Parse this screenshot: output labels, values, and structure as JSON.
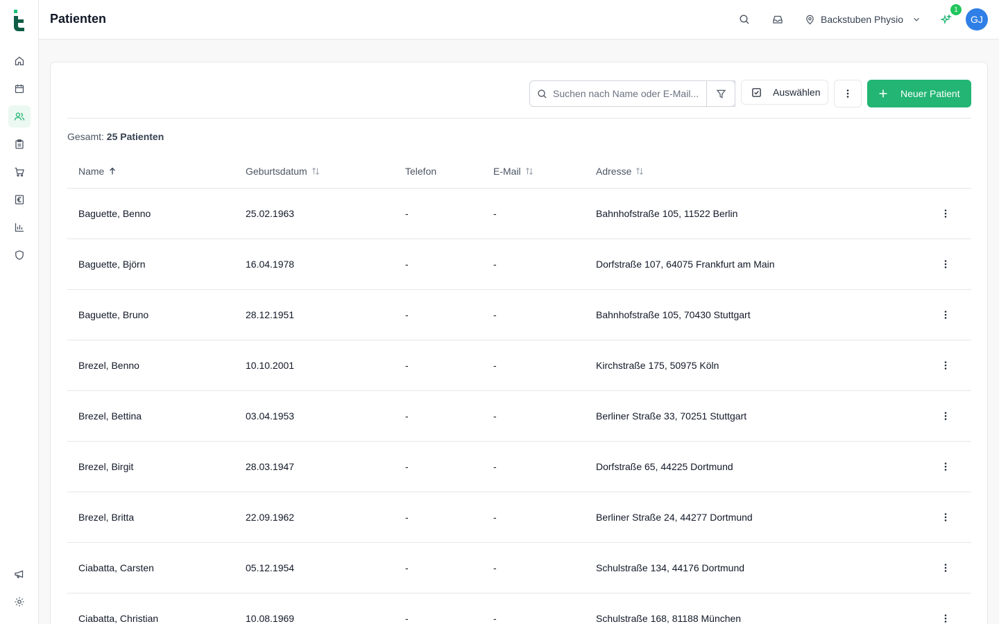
{
  "header": {
    "title": "Patienten",
    "location": "Backstuben Physio",
    "notification_count": "1",
    "avatar_initials": "GJ"
  },
  "sidebar": {
    "items": [
      {
        "icon": "home-icon"
      },
      {
        "icon": "calendar-icon"
      },
      {
        "icon": "users-icon",
        "active": true
      },
      {
        "icon": "clipboard-icon"
      },
      {
        "icon": "cart-icon"
      },
      {
        "icon": "euro-icon"
      },
      {
        "icon": "chart-icon"
      },
      {
        "icon": "shield-icon"
      },
      {
        "icon": "megaphone-icon"
      },
      {
        "icon": "gear-icon"
      }
    ]
  },
  "toolbar": {
    "search_placeholder": "Suchen nach Name oder E-Mail...",
    "select_label": "Auswählen",
    "new_patient_label": "Neuer Patient"
  },
  "summary": {
    "label": "Gesamt:",
    "value": "25 Patienten"
  },
  "table": {
    "columns": [
      "Name",
      "Geburtsdatum",
      "Telefon",
      "E-Mail",
      "Adresse"
    ],
    "rows": [
      {
        "name": "Baguette, Benno",
        "birth": "25.02.1963",
        "phone": "-",
        "email": "-",
        "address": "Bahnhofstraße 105, 11522 Berlin"
      },
      {
        "name": "Baguette, Björn",
        "birth": "16.04.1978",
        "phone": "-",
        "email": "-",
        "address": "Dorfstraße 107, 64075 Frankfurt am Main"
      },
      {
        "name": "Baguette, Bruno",
        "birth": "28.12.1951",
        "phone": "-",
        "email": "-",
        "address": "Bahnhofstraße 105, 70430 Stuttgart"
      },
      {
        "name": "Brezel, Benno",
        "birth": "10.10.2001",
        "phone": "-",
        "email": "-",
        "address": "Kirchstraße 175, 50975 Köln"
      },
      {
        "name": "Brezel, Bettina",
        "birth": "03.04.1953",
        "phone": "-",
        "email": "-",
        "address": "Berliner Straße 33, 70251 Stuttgart"
      },
      {
        "name": "Brezel, Birgit",
        "birth": "28.03.1947",
        "phone": "-",
        "email": "-",
        "address": "Dorfstraße 65, 44225 Dortmund"
      },
      {
        "name": "Brezel, Britta",
        "birth": "22.09.1962",
        "phone": "-",
        "email": "-",
        "address": "Berliner Straße 24, 44277 Dortmund"
      },
      {
        "name": "Ciabatta, Carsten",
        "birth": "05.12.1954",
        "phone": "-",
        "email": "-",
        "address": "Schulstraße 134, 44176 Dortmund"
      },
      {
        "name": "Ciabatta, Christian",
        "birth": "10.08.1969",
        "phone": "-",
        "email": "-",
        "address": "Schulstraße 168, 81188 München"
      }
    ]
  },
  "colors": {
    "accent": "#22b573",
    "brand": "#0f5c46",
    "avatar": "#2f7fe6"
  }
}
